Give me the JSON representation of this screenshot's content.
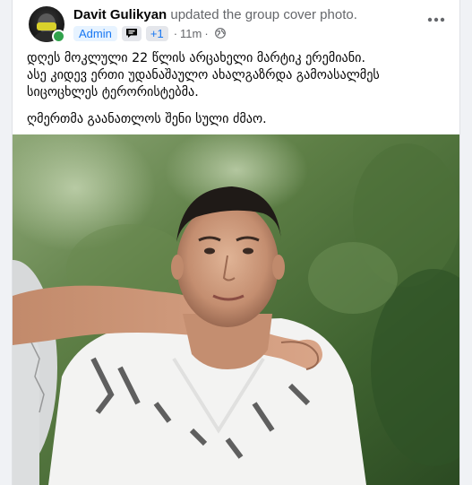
{
  "post": {
    "author": "Davit Gulikyan",
    "action": "updated the group cover photo.",
    "badge_admin": "Admin",
    "badge_count": "+1",
    "time": "11m",
    "separator": "·",
    "visibility_icon": "globe-icon",
    "more_icon": "more-horizontal-icon",
    "paragraphs": [
      "დღეს მოკლული 22 წლის არცახელი მარტიკ ერემიანი.",
      "ასე კიდევ ერთი უდანაშაულო ახალგაზრდა გამოასალმეს",
      "სიცოცხლეს ტერორისტებმა.",
      "ღმერთმა გაანათლოს შენი სული ძმაო."
    ],
    "photo_icon": "cover-photo"
  },
  "colors": {
    "page_bg": "#f0f2f5",
    "card_bg": "#ffffff",
    "text_primary": "#050505",
    "text_secondary": "#65676b",
    "accent": "#1877f2",
    "online": "#31a24c"
  }
}
